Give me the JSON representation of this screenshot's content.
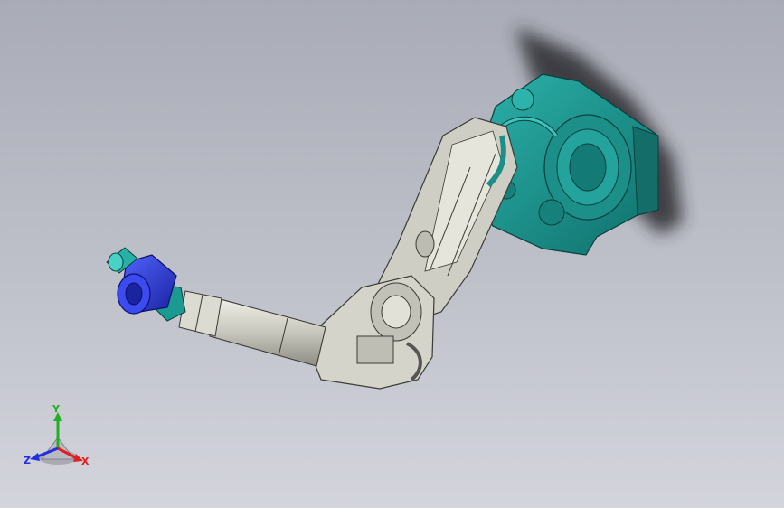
{
  "colors": {
    "background_top": "#a9acb7",
    "background_bottom": "#d3d4dc",
    "base_teal": "#1f9a94",
    "arm_gray": "#c9c8bd",
    "tool_blue": "#2e3fd6",
    "axis_x": "#e02020",
    "axis_y": "#20b020",
    "axis_z": "#2030e0"
  },
  "model": {
    "base_icon": "robot-base-icon",
    "arm_icon": "robot-arm-icon",
    "tool_icon": "end-effector-icon"
  },
  "triad": {
    "x_label": "X",
    "y_label": "Y",
    "z_label": "Z"
  }
}
